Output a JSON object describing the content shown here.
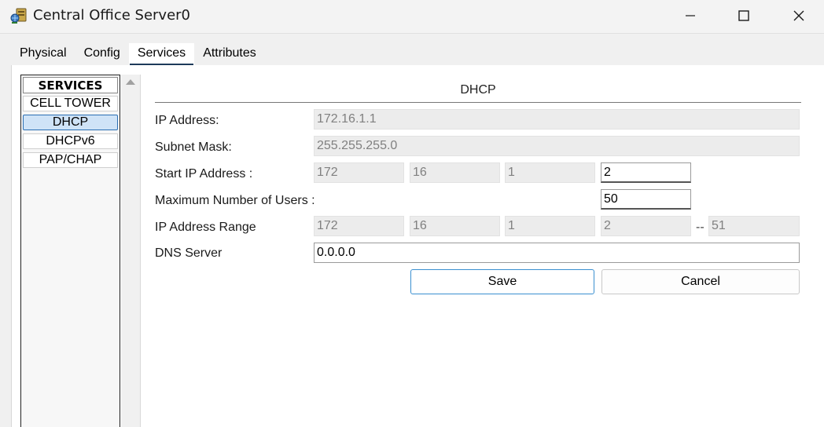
{
  "window": {
    "title": "Central Office Server0",
    "icon": "server-app-icon",
    "controls": [
      "minimize-icon",
      "maximize-icon",
      "close-icon"
    ]
  },
  "tabs": [
    {
      "label": "Physical",
      "active": false
    },
    {
      "label": "Config",
      "active": false
    },
    {
      "label": "Services",
      "active": true
    },
    {
      "label": "Attributes",
      "active": false
    }
  ],
  "services": {
    "header": "SERVICES",
    "items": [
      "CELL TOWER",
      "DHCP",
      "DHCPv6",
      "PAP/CHAP"
    ],
    "selected": "DHCP"
  },
  "dhcp": {
    "title": "DHCP",
    "ip_address": {
      "label": "IP Address:",
      "value": "172.16.1.1"
    },
    "subnet_mask": {
      "label": "Subnet Mask:",
      "value": "255.255.255.0"
    },
    "start_ip": {
      "label": "Start IP Address :",
      "octets": [
        "172",
        "16",
        "1",
        "2"
      ]
    },
    "max_users": {
      "label": "Maximum Number of Users :",
      "value": "50"
    },
    "ip_range": {
      "label": "IP Address Range",
      "octets": [
        "172",
        "16",
        "1",
        "2"
      ],
      "separator": "--",
      "end": "51"
    },
    "dns_server": {
      "label": "DNS Server",
      "value": "0.0.0.0"
    },
    "save_label": "Save",
    "cancel_label": "Cancel"
  },
  "colors": {
    "accent": "#1e3a5a",
    "selected_service": "#cfe3f7",
    "primary_button_border": "#3a8fd0"
  }
}
